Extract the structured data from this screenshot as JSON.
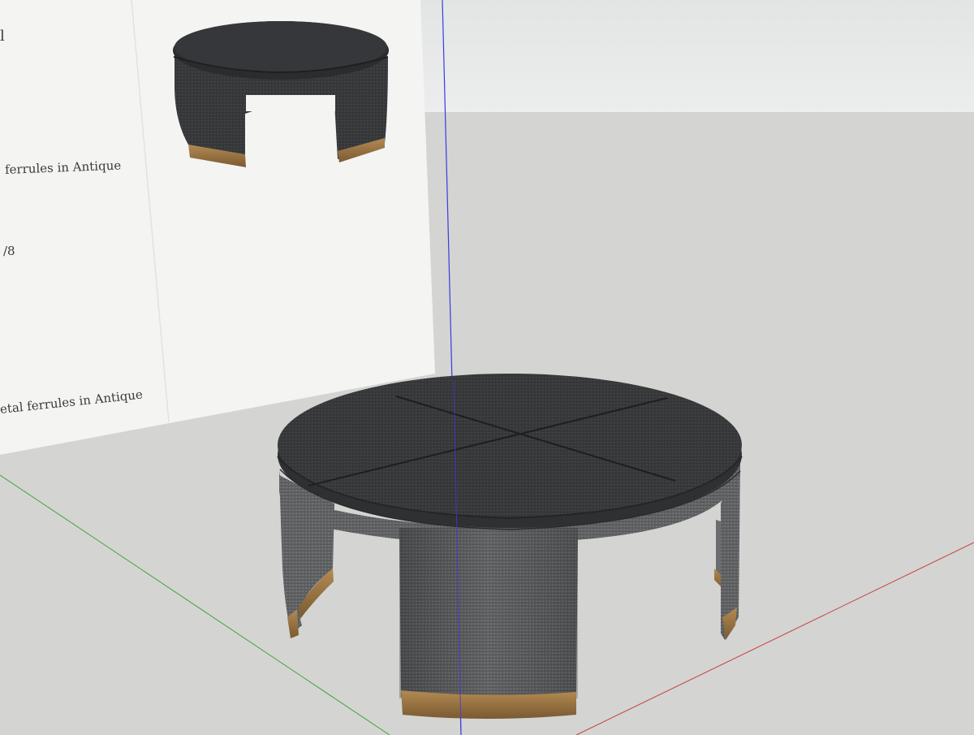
{
  "sheet": {
    "fragments": [
      "l",
      "ferrules in Antique",
      "/8",
      "etal ferrules in Antique"
    ]
  },
  "colors": {
    "sky": "#e6e7e7",
    "ground": "#d4d4d2",
    "sheet": "#f3f3f2",
    "axis_blue": "#3a3ae0",
    "axis_green": "#3aa83a",
    "axis_red": "#c84040",
    "fabric": "#5f6163",
    "tabletop": "#3a3b3d",
    "brass": "#a07a45"
  }
}
